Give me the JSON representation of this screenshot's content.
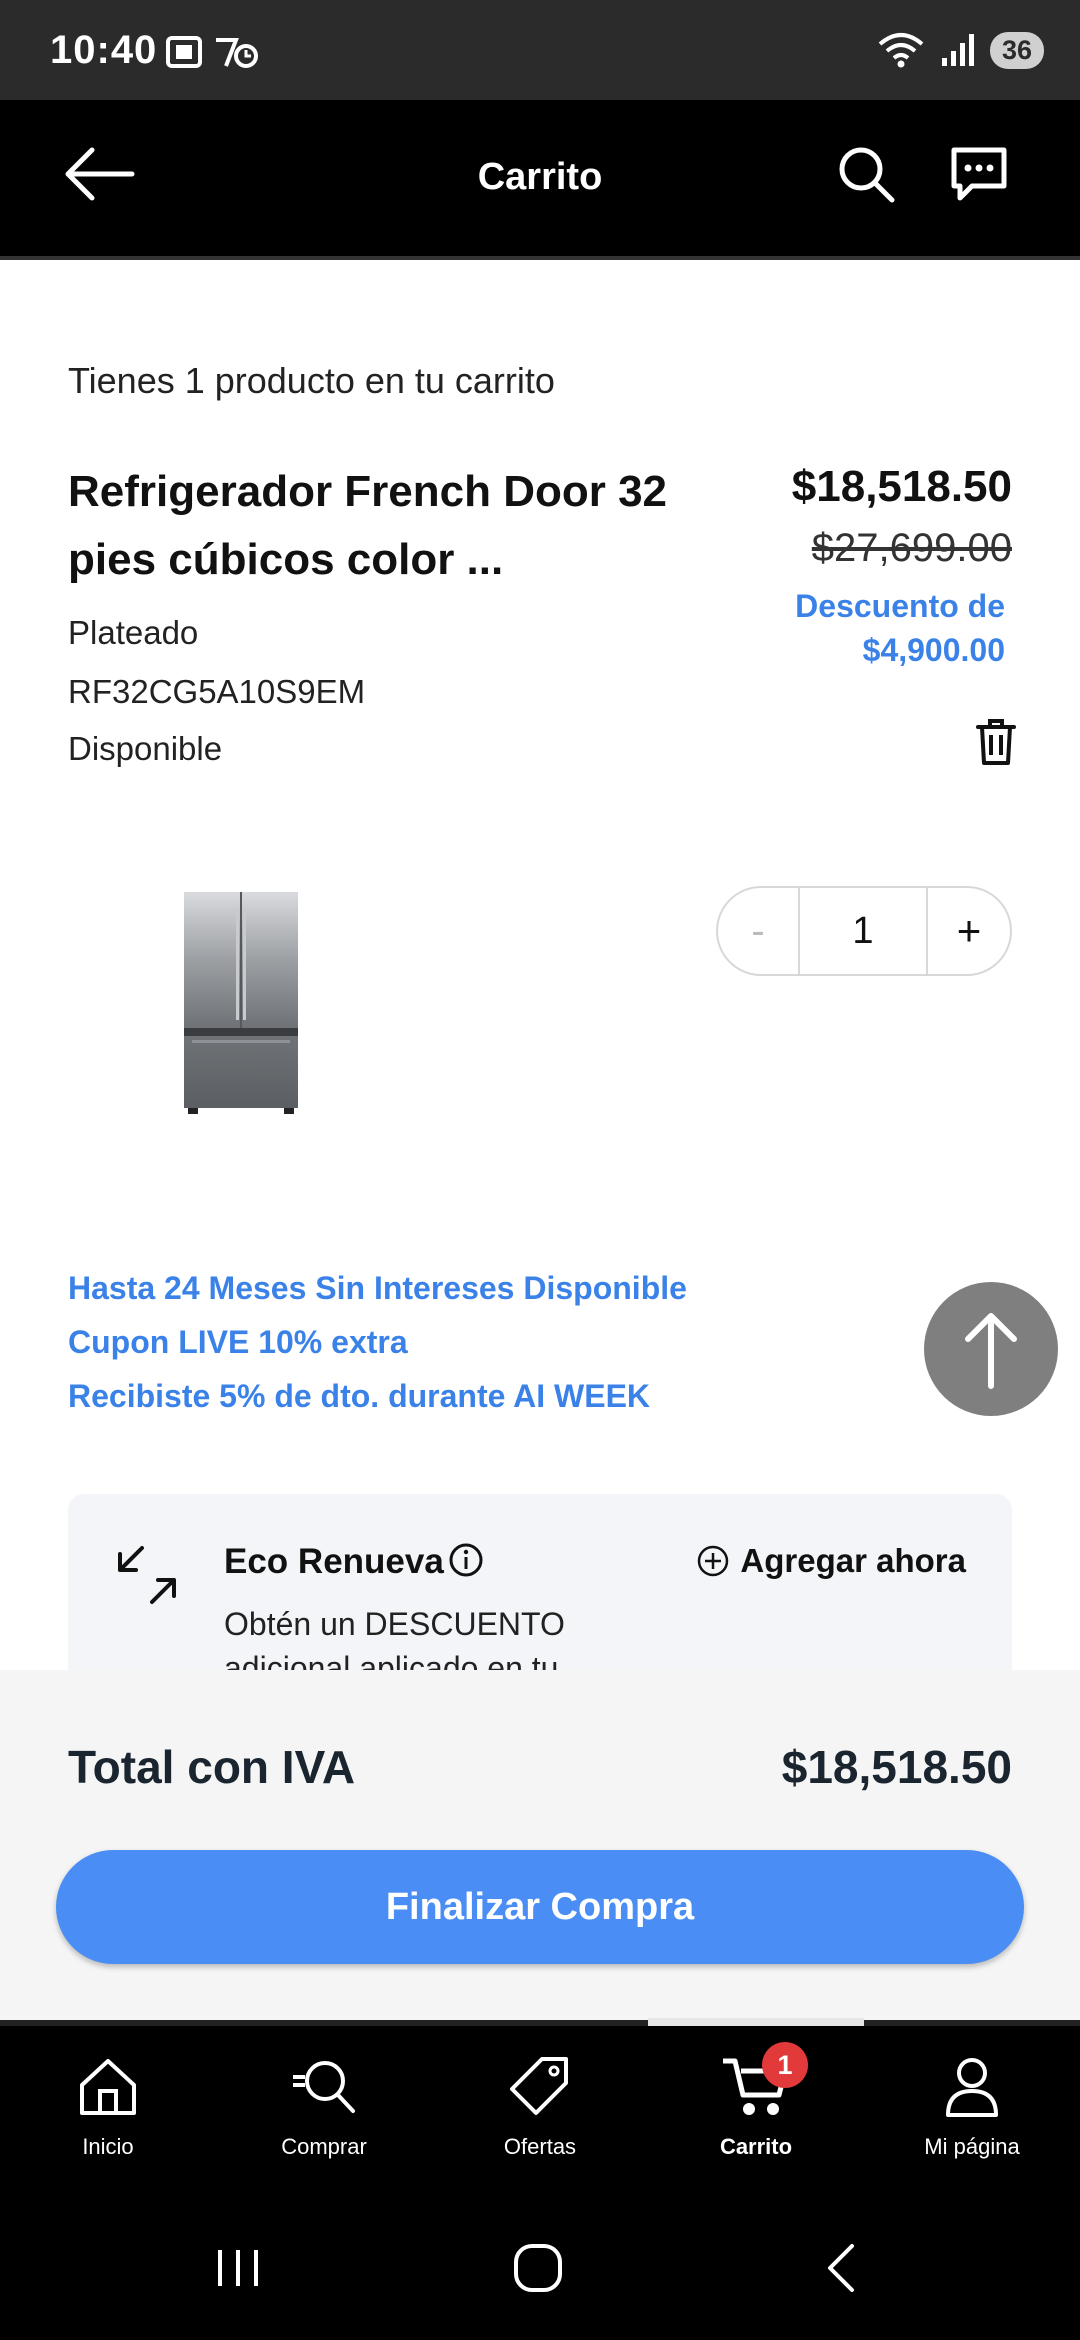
{
  "status_bar": {
    "time": "10:40",
    "battery": "36"
  },
  "header": {
    "title": "Carrito"
  },
  "cart": {
    "count_text": "Tienes 1 producto en tu carrito",
    "product": {
      "name": "Refrigerador French Door 32 pies cúbicos color ...",
      "color": "Plateado",
      "sku": "RF32CG5A10S9EM",
      "availability": "Disponible",
      "price_current": "$18,518.50",
      "price_original": "$27,699.00",
      "discount_text": "Descuento de $4,900.00",
      "quantity": "1",
      "qty_minus": "-",
      "qty_plus": "+"
    },
    "promos": [
      "Hasta 24 Meses Sin Intereses Disponible",
      "Cupon LIVE 10% extra",
      "Recibiste 5% de dto. durante AI WEEK"
    ]
  },
  "eco": {
    "title": "Eco Renueva",
    "add_label": "Agregar ahora",
    "description": "Obtén un DESCUENTO adicional aplicado en tu"
  },
  "total": {
    "label": "Total con IVA",
    "value": "$18,518.50"
  },
  "checkout": {
    "label": "Finalizar Compra"
  },
  "bottom_nav": {
    "items": [
      {
        "label": "Inicio",
        "icon": "home-icon"
      },
      {
        "label": "Comprar",
        "icon": "shop-search-icon"
      },
      {
        "label": "Ofertas",
        "icon": "tag-icon"
      },
      {
        "label": "Carrito",
        "icon": "cart-icon",
        "active": true,
        "badge": "1"
      },
      {
        "label": "Mi página",
        "icon": "user-icon"
      }
    ]
  },
  "colors": {
    "accent_blue": "#3b82e8",
    "button_blue": "#4a8ef5",
    "badge_red": "#e23a3a"
  }
}
